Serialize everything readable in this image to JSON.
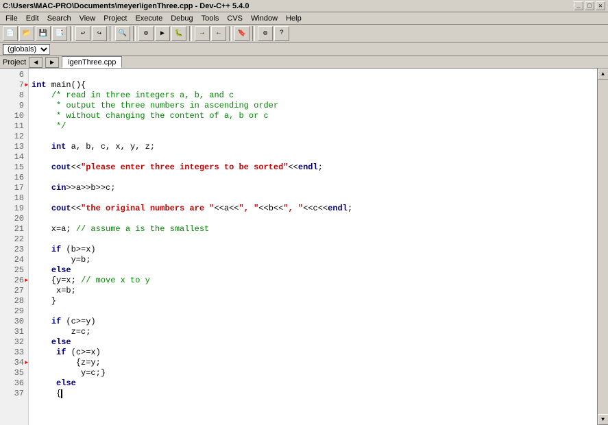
{
  "window": {
    "title": "C:\\Users\\MAC-PRO\\Documents\\meyer\\igenThree.cpp - Dev-C++ 5.4.0",
    "minimize_label": "_",
    "maximize_label": "□",
    "close_label": "✕"
  },
  "menu": {
    "items": [
      "File",
      "Edit",
      "Search",
      "View",
      "Project",
      "Execute",
      "Debug",
      "Tools",
      "CVS",
      "Window",
      "Help"
    ]
  },
  "dropdown": {
    "options": [
      "(globals)"
    ],
    "selected": "(globals)"
  },
  "tabs": {
    "project_label": "Project",
    "file_tab": "igenThree.cpp"
  },
  "code": {
    "lines": [
      {
        "num": 6,
        "content": ""
      },
      {
        "num": 7,
        "content": "int main(){",
        "marker": true
      },
      {
        "num": 8,
        "content": "\t/* read in three integers a, b, and c"
      },
      {
        "num": 9,
        "content": "\t * output the three numbers in ascending order"
      },
      {
        "num": 10,
        "content": "\t * without changing the content of a, b or c"
      },
      {
        "num": 11,
        "content": "\t */"
      },
      {
        "num": 12,
        "content": ""
      },
      {
        "num": 13,
        "content": "\tint a, b, c, x, y, z;"
      },
      {
        "num": 14,
        "content": ""
      },
      {
        "num": 15,
        "content": "\tcout<<\"please enter three integers to be sorted\"<<endl;"
      },
      {
        "num": 16,
        "content": ""
      },
      {
        "num": 17,
        "content": "\tcin>>a>>b>>c;"
      },
      {
        "num": 18,
        "content": ""
      },
      {
        "num": 19,
        "content": "\tcout<<\"the original numbers are \"<<a<<\", \"<<b<<\", \"<<c<<endl;"
      },
      {
        "num": 20,
        "content": ""
      },
      {
        "num": 21,
        "content": "\tx=a; // assume a is the smallest"
      },
      {
        "num": 22,
        "content": ""
      },
      {
        "num": 23,
        "content": "\tif (b>=x)"
      },
      {
        "num": 24,
        "content": "\t\ty=b;"
      },
      {
        "num": 25,
        "content": "\telse"
      },
      {
        "num": 26,
        "content": "\t{y=x; // move x to y",
        "marker": true
      },
      {
        "num": 27,
        "content": "\t x=b;"
      },
      {
        "num": 28,
        "content": "\t}"
      },
      {
        "num": 29,
        "content": ""
      },
      {
        "num": 30,
        "content": "\tif (c>=y)"
      },
      {
        "num": 31,
        "content": "\t\tz=c;"
      },
      {
        "num": 32,
        "content": "\telse"
      },
      {
        "num": 33,
        "content": "\t if (c>=x)"
      },
      {
        "num": 34,
        "content": "\t\t {z=y;",
        "marker": true
      },
      {
        "num": 35,
        "content": "\t\t  y=c;}"
      },
      {
        "num": 36,
        "content": "\t else"
      },
      {
        "num": 37,
        "content": "\t {",
        "cursor": true
      }
    ]
  },
  "colors": {
    "keyword": "#000080",
    "comment": "#008800",
    "string": "#cc0000",
    "background": "#ffffff",
    "line_num_bg": "#f0f0f0",
    "highlight_line": "#c8e8ff"
  }
}
